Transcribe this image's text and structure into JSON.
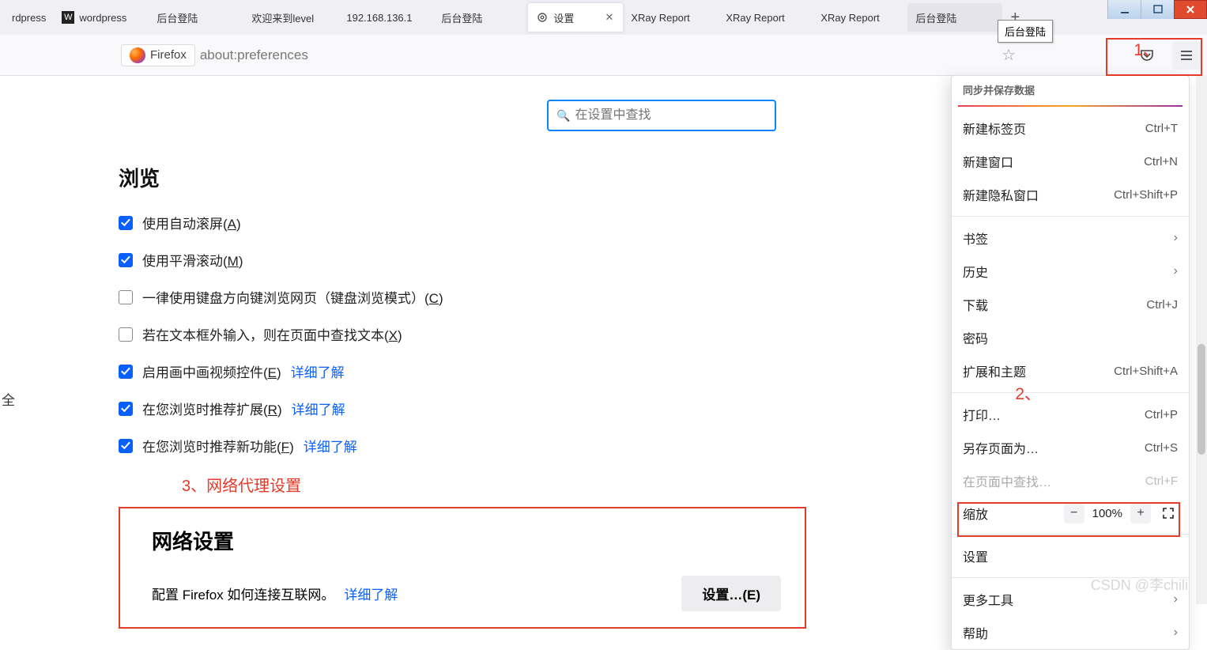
{
  "window": {
    "tooltip": "后台登陆"
  },
  "tabs": [
    {
      "label": "rdpress",
      "trunc": true
    },
    {
      "label": "wordpress",
      "favicon": "W"
    },
    {
      "label": "后台登陆"
    },
    {
      "label": "欢迎来到level"
    },
    {
      "label": "192.168.136.1"
    },
    {
      "label": "后台登陆"
    },
    {
      "label": "设置",
      "active": true,
      "icon": "gear"
    },
    {
      "label": "XRay Report"
    },
    {
      "label": "XRay Report"
    },
    {
      "label": "XRay Report"
    },
    {
      "label": "后台登陆",
      "bg": true
    }
  ],
  "urlbar": {
    "brand": "Firefox",
    "url": "about:preferences"
  },
  "search": {
    "placeholder": "在设置中查找"
  },
  "leftFragment": "全",
  "sections": {
    "browse": {
      "title": "浏览",
      "opts": [
        {
          "checked": true,
          "label_pre": "使用自动滚屏(",
          "key": "A",
          "label_post": ")"
        },
        {
          "checked": true,
          "label_pre": "使用平滑滚动(",
          "key": "M",
          "label_post": ")"
        },
        {
          "checked": false,
          "label_pre": "一律使用键盘方向键浏览网页（键盘浏览模式）(",
          "key": "C",
          "label_post": ")"
        },
        {
          "checked": false,
          "label_pre": "若在文本框外输入，则在页面中查找文本(",
          "key": "X",
          "label_post": ")"
        },
        {
          "checked": true,
          "label_pre": "启用画中画视频控件(",
          "key": "E",
          "label_post": ")",
          "link": "详细了解"
        },
        {
          "checked": true,
          "label_pre": "在您浏览时推荐扩展(",
          "key": "R",
          "label_post": ")",
          "link": "详细了解"
        },
        {
          "checked": true,
          "label_pre": "在您浏览时推荐新功能(",
          "key": "F",
          "label_post": ")",
          "link": "详细了解"
        }
      ]
    },
    "network": {
      "title": "网络设置",
      "desc": "配置 Firefox 如何连接互联网。",
      "link": "详细了解",
      "button": "设置…(E)"
    }
  },
  "annotations": {
    "one": "1、",
    "two": "2、",
    "three": "3、网络代理设置"
  },
  "menu": {
    "header": "同步并保存数据",
    "items1": [
      {
        "label": "新建标签页",
        "sc": "Ctrl+T"
      },
      {
        "label": "新建窗口",
        "sc": "Ctrl+N"
      },
      {
        "label": "新建隐私窗口",
        "sc": "Ctrl+Shift+P"
      }
    ],
    "items2": [
      {
        "label": "书签",
        "chev": true
      },
      {
        "label": "历史",
        "chev": true
      },
      {
        "label": "下载",
        "sc": "Ctrl+J"
      },
      {
        "label": "密码"
      },
      {
        "label": "扩展和主题",
        "sc": "Ctrl+Shift+A"
      }
    ],
    "items3": [
      {
        "label": "打印…",
        "sc": "Ctrl+P"
      },
      {
        "label": "另存页面为…",
        "sc": "Ctrl+S"
      },
      {
        "label": "在页面中查找…",
        "sc": "Ctrl+F",
        "disabled": true
      }
    ],
    "zoom": {
      "label": "缩放",
      "value": "100%"
    },
    "items4": [
      {
        "label": "设置"
      }
    ],
    "items5": [
      {
        "label": "更多工具",
        "chev": true
      },
      {
        "label": "帮助",
        "chev": true
      }
    ]
  },
  "watermark": "CSDN @李chili"
}
